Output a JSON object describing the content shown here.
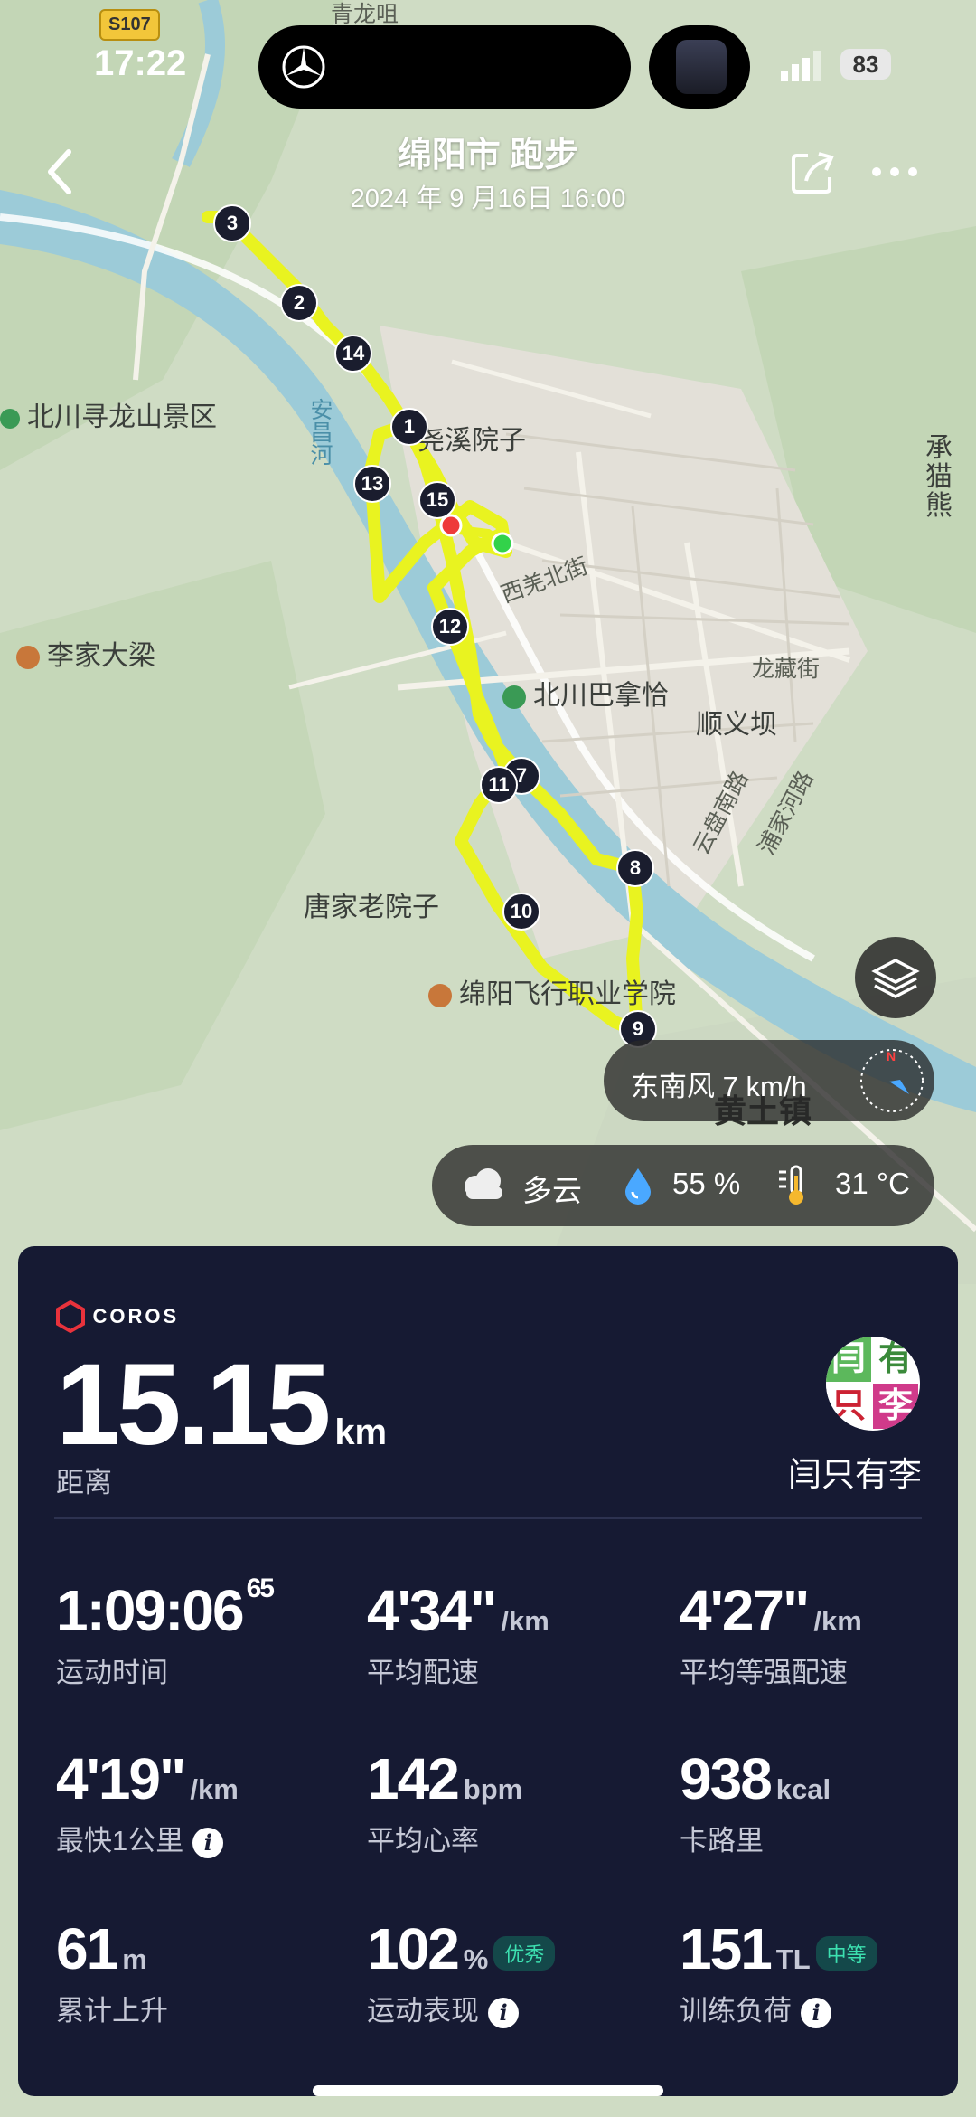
{
  "status_bar": {
    "time": "17:22",
    "battery": "83"
  },
  "header": {
    "title": "绵阳市 跑步",
    "subtitle": "2024 年 9 月16日 16:00"
  },
  "map": {
    "labels": {
      "road_badge": "S107",
      "qinglongzui": "青龙咀",
      "beichuan_xunlong": "北川寻龙山景区",
      "yuxi_yuanzi": "尧溪院子",
      "anchang_river": "安昌河",
      "xiqiang_st": "西羌北街",
      "lijia_daliang": "李家大梁",
      "beichuan_banaqia": "北川巴拿恰",
      "longzang_st": "龙藏街",
      "shunyiba": "顺义坝",
      "yunpan_rd": "云盘南路",
      "pujia_rd": "浦家河路",
      "tangjia_yuanzi": "唐家老院子",
      "mianyang_flight": "绵阳飞行职业学院",
      "chengmao_bear": "承猫熊",
      "huangtuzhen": "黄土镇"
    },
    "markers": [
      "1",
      "2",
      "3",
      "7",
      "8",
      "9",
      "10",
      "11",
      "12",
      "13",
      "14",
      "15"
    ],
    "route_color": "#e9f320"
  },
  "weather": {
    "wind": "东南风 7 km/h",
    "sky": "多云",
    "humidity": "55 %",
    "temperature": "31 °C"
  },
  "summary": {
    "brand": "COROS",
    "distance_value": "15.15",
    "distance_unit": "km",
    "distance_label": "距离",
    "user_name": "闫只有李",
    "avatar_chars": [
      "闫",
      "有",
      "只",
      "李"
    ],
    "stats": [
      {
        "value": "1:09:06",
        "sup": "65",
        "unit": "",
        "label": "运动时间"
      },
      {
        "value": "4'34\"",
        "unit": "/km",
        "label": "平均配速"
      },
      {
        "value": "4'27\"",
        "unit": "/km",
        "label": "平均等强配速"
      },
      {
        "value": "4'19\"",
        "unit": "/km",
        "label": "最快1公里"
      },
      {
        "value": "142",
        "unit": "bpm",
        "label": "平均心率"
      },
      {
        "value": "938",
        "unit": "kcal",
        "label": "卡路里"
      },
      {
        "value": "61",
        "unit": "m",
        "label": "累计上升"
      },
      {
        "value": "102",
        "unit": "%",
        "badge": "优秀",
        "label": "运动表现"
      },
      {
        "value": "151",
        "unit": "TL",
        "badge": "中等",
        "label": "训练负荷"
      }
    ]
  }
}
